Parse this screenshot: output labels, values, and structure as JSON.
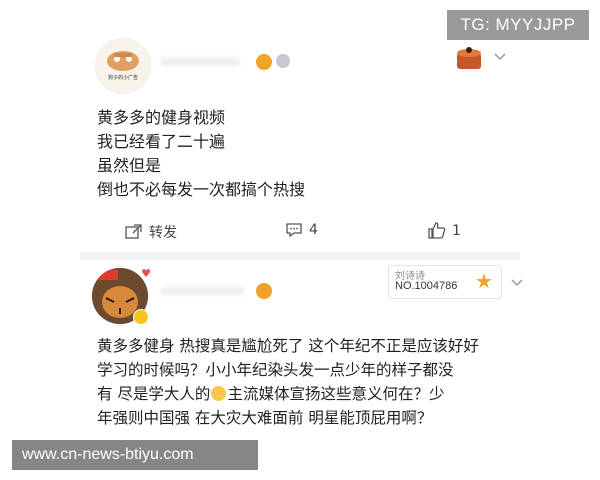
{
  "watermark": {
    "tg_label": "TG: MYYJJPP"
  },
  "source_url": "www.cn-news-btiyu.com",
  "post1": {
    "avatar_caption": "狗子的小广告",
    "lines": [
      "黄多多的健身视频",
      "我已经看了二十遍",
      "虽然但是",
      "倒也不必每发一次都搞个热搜"
    ],
    "repost_label": "转发",
    "comment_count": "4",
    "like_count": "1"
  },
  "post2": {
    "fan_badge_name": "刘诗诗",
    "fan_badge_number": "NO.1004786",
    "lines": [
      "黄多多健身 热搜真是尴尬死了 这个年纪不正是应该好好",
      "学习的时候吗？小小年纪染头发一点少年的样子都没",
      "有 尽是学大人的",
      "主流媒体宣扬这些意义何在？少",
      "年强则中国强 在大灾大难面前 明星能顶屁用啊？"
    ]
  },
  "colors": {
    "accent_orange": "#f0a22a",
    "text": "#222222",
    "muted": "#666666"
  },
  "icons": [
    "chevron-down-icon",
    "repost-icon",
    "comment-icon",
    "like-icon",
    "emoji-icon",
    "vip-badge-icon"
  ]
}
